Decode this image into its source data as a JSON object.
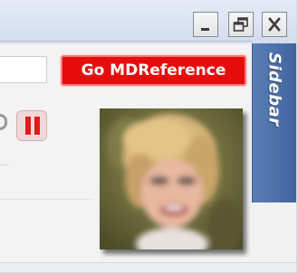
{
  "window": {
    "controls": {
      "minimize_icon": "minimize-icon",
      "restore_icon": "restore-icon",
      "close_icon": "close-icon"
    }
  },
  "toolbar": {
    "search": {
      "value": "",
      "placeholder": ""
    },
    "go_button_label": "Go MDReference",
    "go_button_color": "#e60d0d",
    "pause_icon": "pause-icon",
    "pause_color": "#e31b1b"
  },
  "sidebar": {
    "label": "Sidebar",
    "color": "#4a6fa8"
  },
  "avatar": {
    "icon": "user-photo"
  }
}
